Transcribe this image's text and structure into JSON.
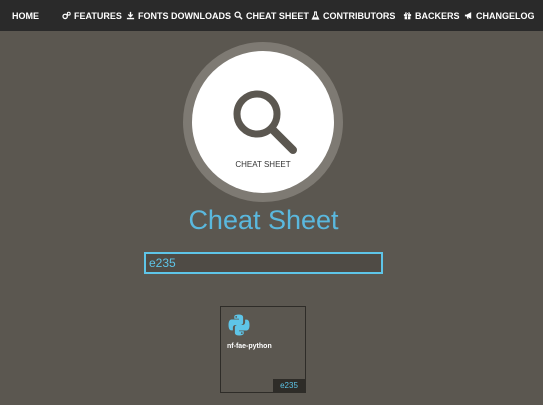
{
  "nav": {
    "home": "HOME",
    "features": "FEATURES",
    "fonts_downloads": "FONTS DOWNLOADS",
    "cheat_sheet": "CHEAT SHEET",
    "contributors": "CONTRIBUTORS",
    "backers": "BACKERS",
    "changelog": "CHANGELOG"
  },
  "hero": {
    "icon": "magnifier-icon",
    "caption": "CHEAT SHEET"
  },
  "page_title": "Cheat Sheet",
  "search": {
    "value": "e235"
  },
  "results": [
    {
      "name": "nf-fae-python",
      "code": "e235",
      "icon": "python-icon"
    }
  ],
  "colors": {
    "background": "#5b5750",
    "nav_background": "#2a2a2a",
    "accent": "#5ec5e8",
    "title": "#5ab8de"
  }
}
